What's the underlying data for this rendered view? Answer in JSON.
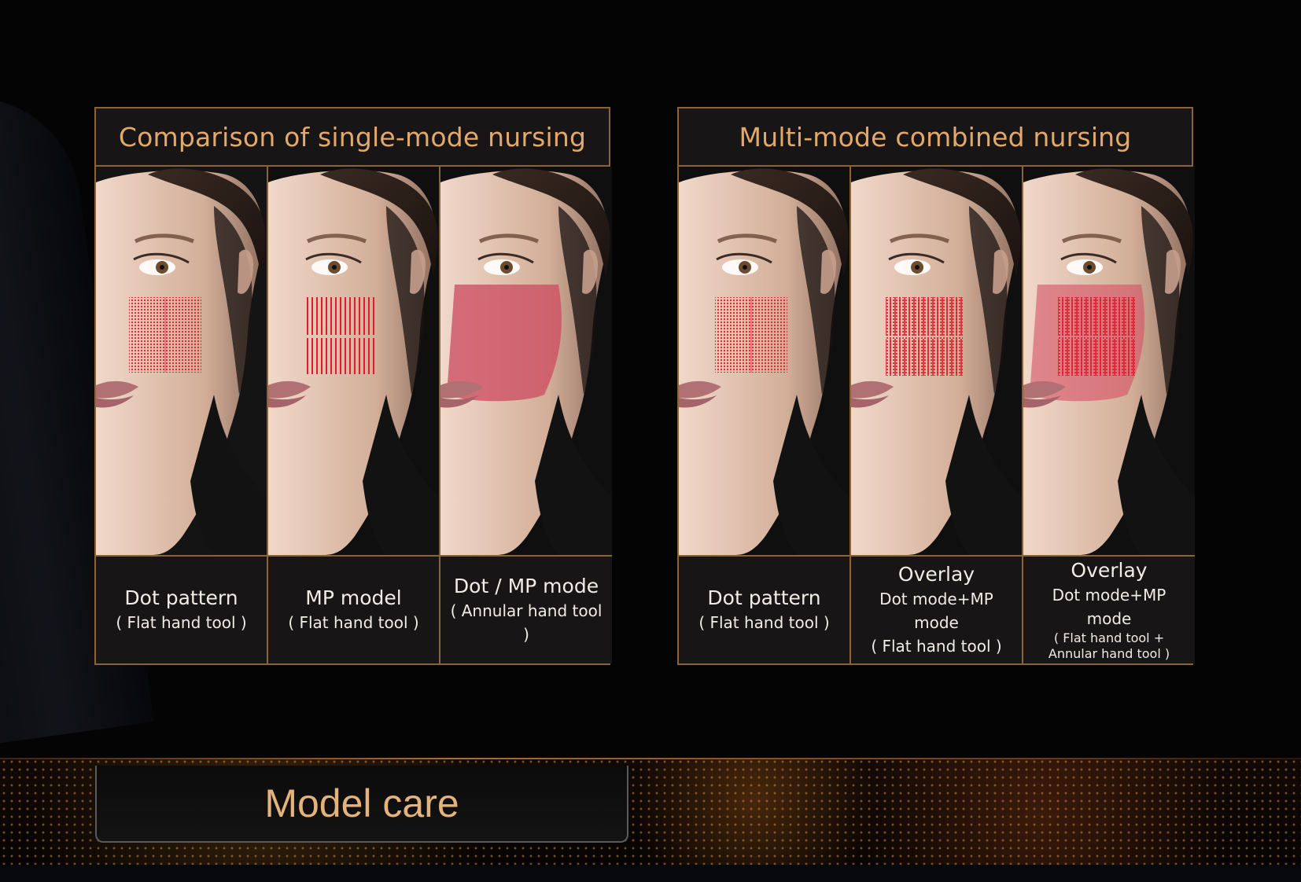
{
  "panels": {
    "single": {
      "title": "Comparison of single-mode nursing",
      "items": [
        {
          "title": "Dot pattern",
          "sub": "( Flat hand tool )",
          "mode": "dot"
        },
        {
          "title": "MP model",
          "sub": "( Flat hand tool )",
          "mode": "mp"
        },
        {
          "title": "Dot / MP mode",
          "sub": "( Annular hand tool )",
          "mode": "annular"
        }
      ]
    },
    "multi": {
      "title": "Multi-mode combined nursing",
      "items": [
        {
          "title": "Dot pattern",
          "sub": "( Flat hand tool )",
          "mode": "dot"
        },
        {
          "title": "Overlay",
          "sub1": "Dot mode+MP mode",
          "sub2": "( Flat hand tool )",
          "mode": "overlay"
        },
        {
          "title": "Overlay",
          "sub1": "Dot mode+MP mode",
          "sub2": "( Flat hand tool +",
          "sub3": "Annular hand tool )",
          "mode": "overlay-annular"
        }
      ]
    }
  },
  "footer": {
    "title": "Model care"
  },
  "colors": {
    "gold": "#8a6437",
    "title": "#e2a96b",
    "red": "#d61f28",
    "caption": "#f1ece6"
  }
}
